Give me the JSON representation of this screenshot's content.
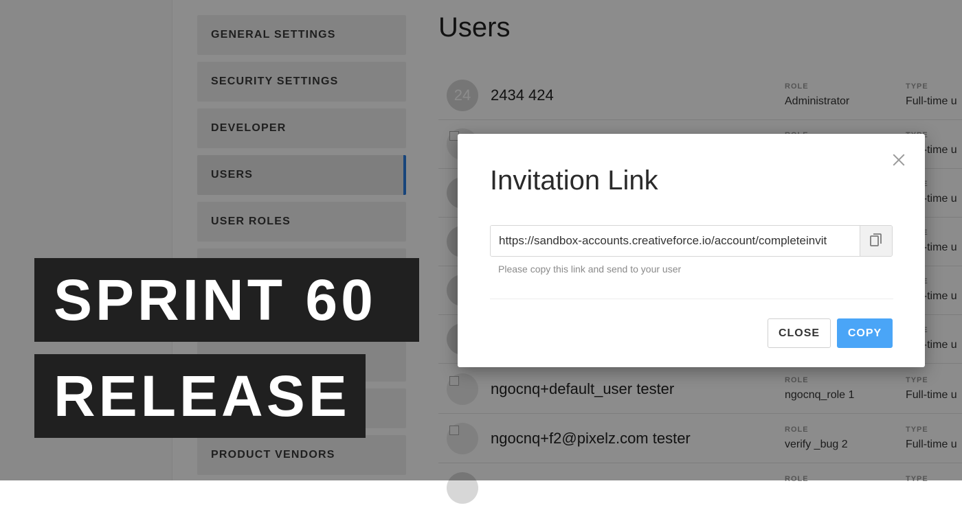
{
  "sidebar": {
    "items": [
      {
        "label": "GENERAL SETTINGS"
      },
      {
        "label": "SECURITY SETTINGS"
      },
      {
        "label": "DEVELOPER"
      },
      {
        "label": "USERS",
        "active": true
      },
      {
        "label": "USER ROLES"
      },
      {
        "label": "PRODUCT VENDORS"
      }
    ]
  },
  "page": {
    "title": "Users"
  },
  "columns": {
    "role": "ROLE",
    "type": "TYPE"
  },
  "users": [
    {
      "avatar_text": "24",
      "name": "2434 424",
      "role": "Administrator",
      "type": "Full-time u"
    },
    {
      "avatar_text": "",
      "name": "",
      "role": "",
      "type": "Full-time u"
    },
    {
      "avatar_text": "",
      "name": "",
      "role": "",
      "type": "Full-time u"
    },
    {
      "avatar_text": "",
      "name": "",
      "role": "",
      "type": "Full-time u"
    },
    {
      "avatar_text": "",
      "name": "",
      "role": "",
      "type": "Full-time u"
    },
    {
      "avatar_text": "",
      "name": "",
      "role": "",
      "type": "Full-time u"
    },
    {
      "avatar_text": "",
      "name": "ngocnq+default_user tester",
      "role": "ngocnq_role 1",
      "type": "Full-time u"
    },
    {
      "avatar_text": "",
      "name": "ngocnq+f2@pixelz.com tester",
      "role": "verify _bug 2",
      "type": "Full-time u"
    }
  ],
  "modal": {
    "title": "Invitation Link",
    "link_value": "https://sandbox-accounts.creativeforce.io/account/completeinvit",
    "hint": "Please copy this link and send to your user",
    "close_label": "CLOSE",
    "copy_label": "COPY",
    "icons": {
      "close": "close-icon",
      "copy": "clipboard-icon"
    }
  },
  "banner": {
    "line1": "SPRINT 60",
    "line2": "RELEASE"
  },
  "colors": {
    "accent": "#4aa5f7",
    "active_indicator": "#2d7fe0",
    "banner_bg": "#202020"
  }
}
